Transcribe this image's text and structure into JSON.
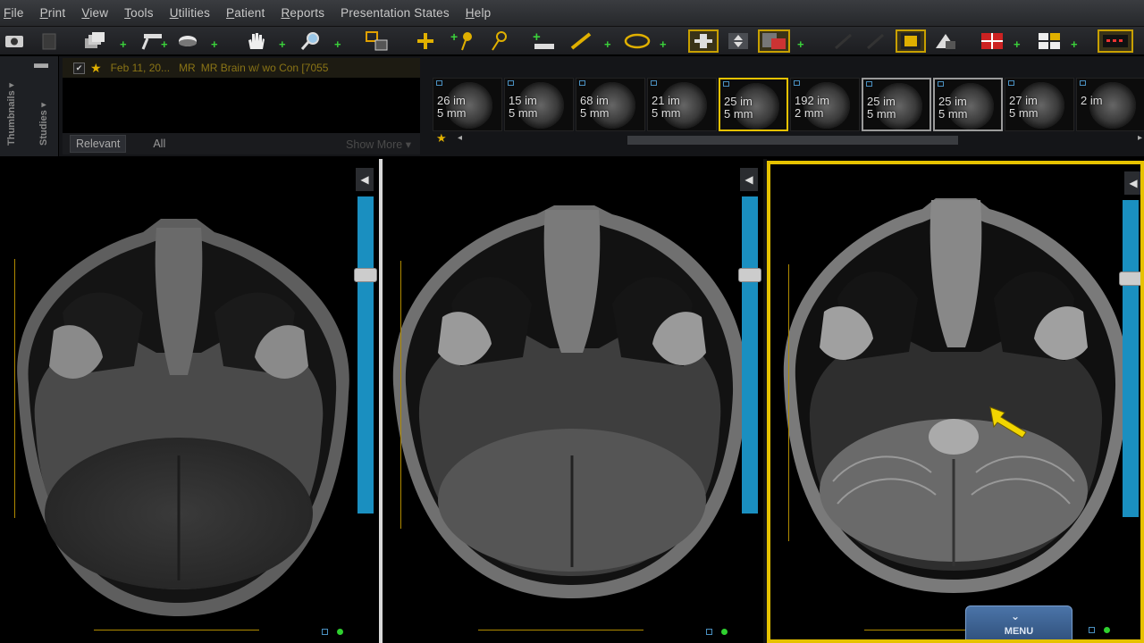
{
  "menubar": {
    "items": [
      {
        "first": "F",
        "rest": "ile"
      },
      {
        "first": "P",
        "rest": "rint"
      },
      {
        "first": "V",
        "rest": "iew"
      },
      {
        "first": "T",
        "rest": "ools"
      },
      {
        "first": "U",
        "rest": "tilities"
      },
      {
        "first": "P",
        "rest": "atient"
      },
      {
        "first": "R",
        "rest": "eports"
      },
      {
        "first": "",
        "rest": "Presentation States"
      },
      {
        "first": "H",
        "rest": "elp"
      }
    ]
  },
  "side_tabs": {
    "thumbnails": "Thumbnails ▾",
    "studies": "Studies ▾"
  },
  "study": {
    "date": "Feb 11, 20...",
    "modality": "MR",
    "description": "MR Brain w/ wo Con [7055"
  },
  "study_filters": {
    "relevant": "Relevant",
    "all": "All",
    "show_more": "Show More ▾"
  },
  "thumbnails": [
    {
      "images": "26 im",
      "thickness": "5 mm"
    },
    {
      "images": "15 im",
      "thickness": "5 mm"
    },
    {
      "images": "68 im",
      "thickness": "5 mm"
    },
    {
      "images": "21 im",
      "thickness": "5 mm"
    },
    {
      "images": "25 im",
      "thickness": "5 mm"
    },
    {
      "images": "192 im",
      "thickness": "2 mm"
    },
    {
      "images": "25 im",
      "thickness": "5 mm"
    },
    {
      "images": "25 im",
      "thickness": "5 mm"
    },
    {
      "images": "27 im",
      "thickness": "5 mm"
    },
    {
      "images": "2 im",
      "thickness": ""
    }
  ],
  "viewport_menu": {
    "label": "MENU"
  },
  "colors": {
    "active_border": "#e6c200",
    "slider": "#1a8fc0",
    "ruler": "#b08a00",
    "arrow": "#f2d600"
  },
  "icons": [
    "screenshot-icon",
    "copy-icon",
    "stack-icon",
    "window-level-icon",
    "eye-icon",
    "pan-hand-icon",
    "zoom-icon",
    "localizer-icon",
    "crosshair-icon",
    "pin-icon",
    "measure-icon",
    "ruler-icon",
    "ellipse-icon",
    "scroll-icon",
    "flip-icon",
    "image-swap-icon",
    "layout-icon",
    "invert-icon",
    "grid-red-icon",
    "grid-white-icon",
    "annotation-icon"
  ]
}
